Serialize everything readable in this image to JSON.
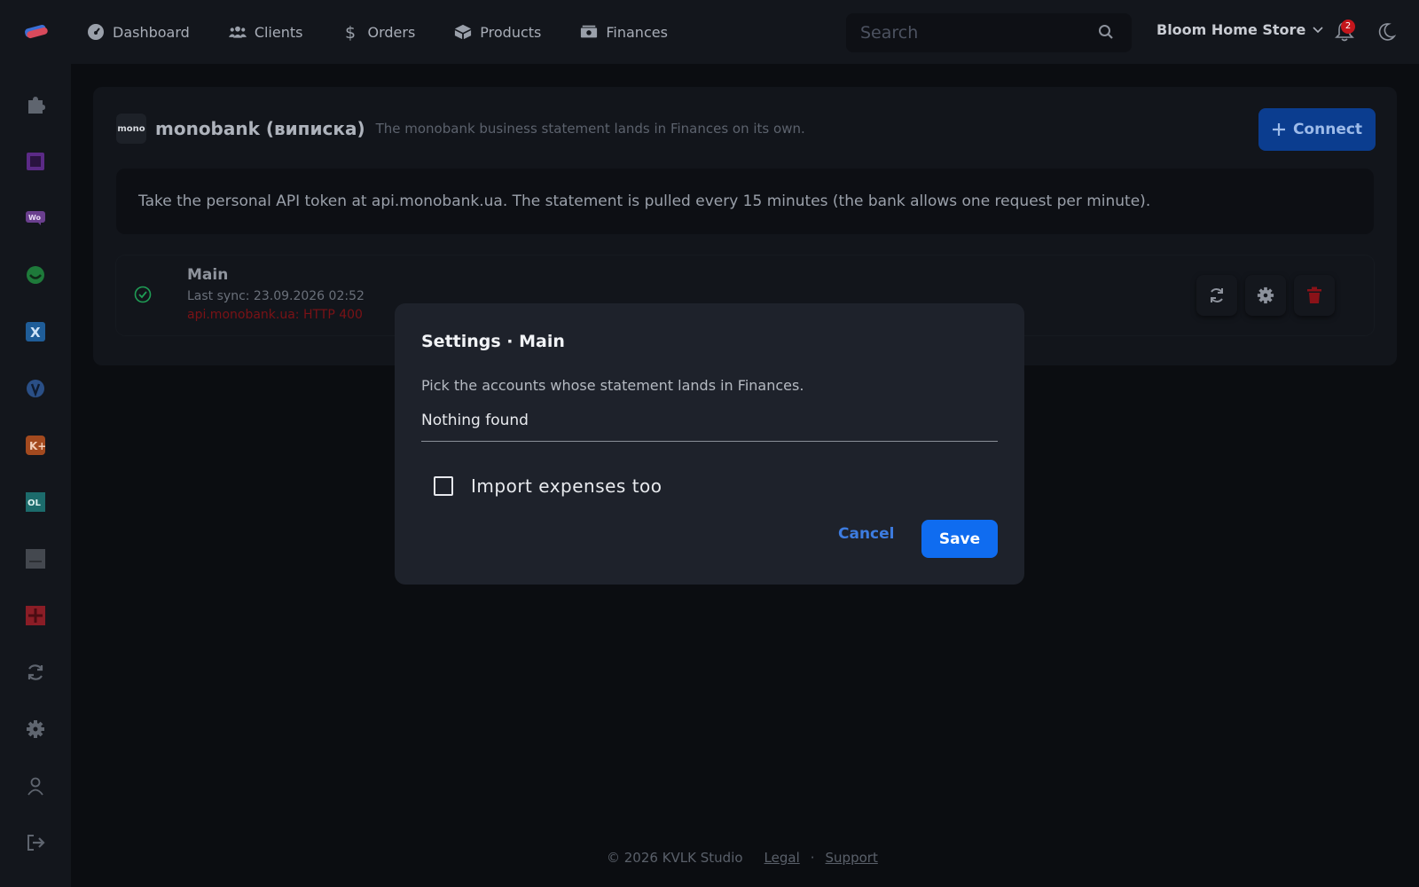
{
  "topbar": {
    "nav": [
      {
        "label": "Dashboard",
        "icon": "gauge-icon"
      },
      {
        "label": "Clients",
        "icon": "users-icon"
      },
      {
        "label": "Orders",
        "icon": "dollar-icon"
      },
      {
        "label": "Products",
        "icon": "box-icon"
      },
      {
        "label": "Finances",
        "icon": "money-icon"
      }
    ],
    "search_placeholder": "Search",
    "store_name": "Bloom Home Store",
    "notifications_count": "2"
  },
  "card": {
    "logo_text": "mono",
    "title": "monobank (виписка)",
    "subtitle": "The monobank business statement lands in Finances on its own.",
    "connect_label": "Connect",
    "info": "Take the personal API token at api.monobank.ua. The statement is pulled every 15 minutes (the bank allows one request per minute).",
    "account": {
      "name": "Main",
      "last_sync": "Last sync: 23.09.2026 02:52",
      "error": "api.monobank.ua: HTTP 400"
    }
  },
  "modal": {
    "title": "Settings · Main",
    "description": "Pick the accounts whose statement lands in Finances.",
    "select_value": "Nothing found",
    "checkbox_label": "Import expenses too",
    "checkbox_checked": false,
    "cancel_label": "Cancel",
    "save_label": "Save"
  },
  "footer": {
    "copyright": "© 2026 KVLK Studio",
    "legal": "Legal",
    "separator": "·",
    "support": "Support"
  },
  "colors": {
    "accent": "#0f6cf0",
    "error": "#c4161c",
    "success": "#1f9d55"
  }
}
